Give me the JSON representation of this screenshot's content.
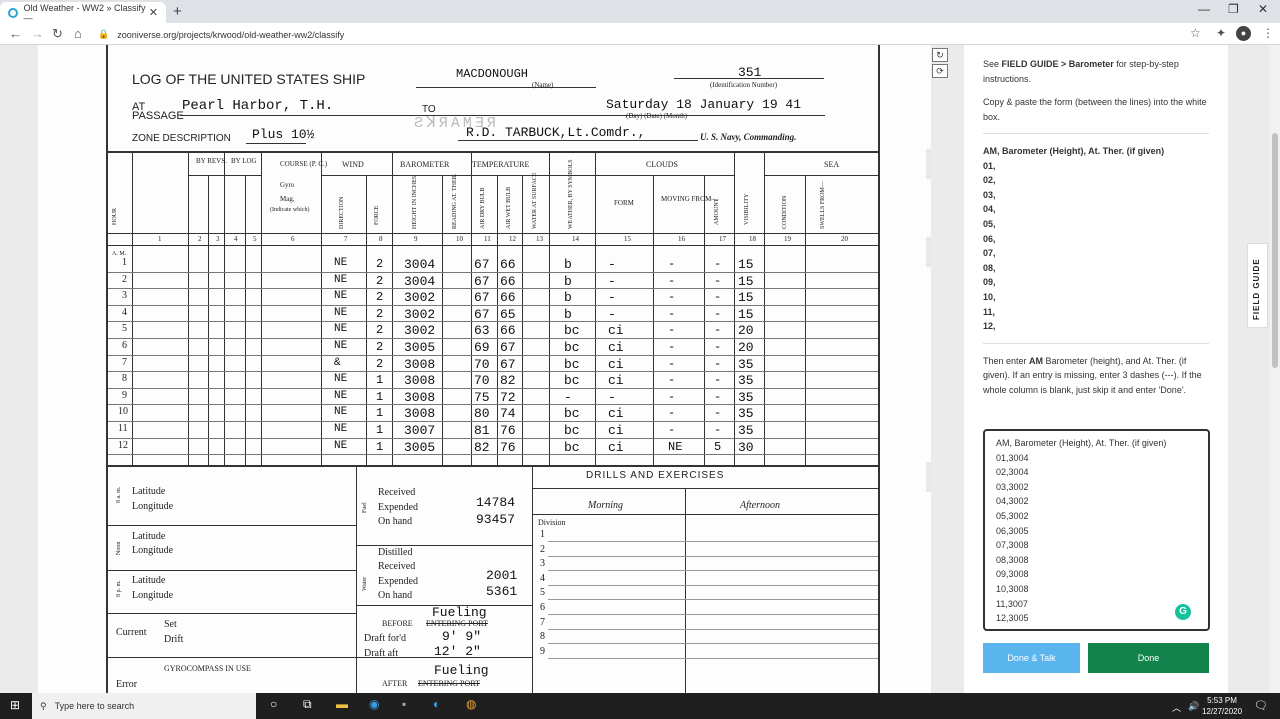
{
  "browser": {
    "tab_title": "Old Weather - WW2 » Classify —",
    "tab_close": "✕",
    "new_tab": "+",
    "url": "zooniverse.org/projects/krwood/old-weather-ww2/classify"
  },
  "log": {
    "header_title": "LOG OF THE UNITED STATES SHIP",
    "ship_name": "MACDONOUGH",
    "name_caption": "(Name)",
    "ident_number": "351",
    "ident_caption": "(Identification Number)",
    "at_label": "AT",
    "passage_label": "PASSAGE",
    "location": "Pearl Harbor, T.H.",
    "to_label": "TO",
    "date_value": "Saturday 18  January 19 41",
    "date_caption": "(Day)     (Date)      (Month)",
    "zone_label": "ZONE DESCRIPTION",
    "zone_value": "Plus 10½",
    "commander": "R.D. TARBUCK,Lt.Comdr.,",
    "commanding_label": "U. S. Navy, Commanding.",
    "col_labels": {
      "hour": "HOUR",
      "revs": "BY REVS.",
      "log": "BY LOG",
      "course": "COURSE (P. C.)",
      "gyro": "Gyro",
      "mag": "Mag.",
      "indicate": "(Indicate which)",
      "wind": "WIND",
      "direction": "DIRECTION",
      "force": "FORCE",
      "barometer": "BAROMETER",
      "height": "HEIGHT IN INCHES",
      "reading": "READING AT. THER.",
      "temperature": "TEMPERATURE",
      "dry": "AIR DRY BULB",
      "wet": "AIR WET BULB",
      "water": "WATER AT SURFACE",
      "weather": "WEATHER, BY SYMBOLS",
      "clouds": "CLOUDS",
      "form": "FORM",
      "moving": "MOVING FROM—",
      "amount": "AMOUNT",
      "visibility": "VISIBILITY",
      "sea": "SEA",
      "condition": "CONDITION",
      "swells": "SWELLS FROM—"
    },
    "col_numbers": [
      "1",
      "2",
      "3",
      "4",
      "5",
      "6",
      "7",
      "8",
      "9",
      "10",
      "11",
      "12",
      "13",
      "14",
      "15",
      "16",
      "17",
      "18",
      "19",
      "20"
    ],
    "am_label": "A. M.",
    "rows": [
      {
        "hour": "1",
        "dir": "NE",
        "force": "2",
        "baro": "3004",
        "dry": "67",
        "wet": "66",
        "weather": "b",
        "form": "-",
        "moving": "-",
        "amount": "-",
        "vis": "15"
      },
      {
        "hour": "2",
        "dir": "NE",
        "force": "2",
        "baro": "3004",
        "dry": "67",
        "wet": "66",
        "weather": "b",
        "form": "-",
        "moving": "-",
        "amount": "-",
        "vis": "15"
      },
      {
        "hour": "3",
        "dir": "NE",
        "force": "2",
        "baro": "3002",
        "dry": "67",
        "wet": "66",
        "weather": "b",
        "form": "-",
        "moving": "-",
        "amount": "-",
        "vis": "15"
      },
      {
        "hour": "4",
        "dir": "NE",
        "force": "2",
        "baro": "3002",
        "dry": "67",
        "wet": "65",
        "weather": "b",
        "form": "-",
        "moving": "-",
        "amount": "-",
        "vis": "15"
      },
      {
        "hour": "5",
        "dir": "NE",
        "force": "2",
        "baro": "3002",
        "dry": "63",
        "wet": "66",
        "weather": "bc",
        "form": "ci",
        "moving": "-",
        "amount": "-",
        "vis": "20"
      },
      {
        "hour": "6",
        "dir": "NE",
        "force": "2",
        "baro": "3005",
        "dry": "69",
        "wet": "67",
        "weather": "bc",
        "form": "ci",
        "moving": "-",
        "amount": "-",
        "vis": "20"
      },
      {
        "hour": "7",
        "dir": "&",
        "force": "2",
        "baro": "3008",
        "dry": "70",
        "wet": "67",
        "weather": "bc",
        "form": "ci",
        "moving": "-",
        "amount": "-",
        "vis": "35"
      },
      {
        "hour": "8",
        "dir": "NE",
        "force": "1",
        "baro": "3008",
        "dry": "70",
        "wet": "82",
        "weather": "bc",
        "form": "ci",
        "moving": "-",
        "amount": "-",
        "vis": "35"
      },
      {
        "hour": "9",
        "dir": "NE",
        "force": "1",
        "baro": "3008",
        "dry": "75",
        "wet": "72",
        "weather": "-",
        "form": "-",
        "moving": "-",
        "amount": "-",
        "vis": "35"
      },
      {
        "hour": "10",
        "dir": "NE",
        "force": "1",
        "baro": "3008",
        "dry": "80",
        "wet": "74",
        "weather": "bc",
        "form": "ci",
        "moving": "-",
        "amount": "-",
        "vis": "35"
      },
      {
        "hour": "11",
        "dir": "NE",
        "force": "1",
        "baro": "3007",
        "dry": "81",
        "wet": "76",
        "weather": "bc",
        "form": "ci",
        "moving": "-",
        "amount": "-",
        "vis": "35"
      },
      {
        "hour": "12",
        "dir": "NE",
        "force": "1",
        "baro": "3005",
        "dry": "82",
        "wet": "76",
        "weather": "bc",
        "form": "ci",
        "moving": "NE",
        "amount": "5",
        "vis": "30"
      }
    ],
    "lower": {
      "latitude": "Latitude",
      "longitude": "Longitude",
      "am_label": "8 a. m.",
      "noon_label": "Noon",
      "pm_label": "8 p. m.",
      "current": "Current",
      "set": "Set",
      "drift": "Drift",
      "gyrocompass": "GYROCOMPASS IN USE",
      "error": "Error",
      "fuel_label": "Fuel",
      "water_label": "Water",
      "received": "Received",
      "expended": "Expended",
      "on_hand": "On hand",
      "distilled": "Distilled",
      "fuel_expended": "14784",
      "fuel_on_hand": "93457",
      "water_expended": "2001",
      "water_on_hand": "5361",
      "before": "BEFORE",
      "after": "AFTER",
      "entering_port": "ENTERING PORT",
      "fueling1": "Fueling",
      "fueling2": "Fueling",
      "draft_fwd_label": "Draft for'd",
      "draft_aft_label": "Draft aft",
      "draft_fwd": "9' 9\"",
      "draft_aft": "12' 2\"",
      "drills": "DRILLS AND EXERCISES",
      "morning": "Morning",
      "afternoon": "Afternoon",
      "division": "Division",
      "div_numbers": [
        "1",
        "2",
        "3",
        "4",
        "5",
        "6",
        "7",
        "8",
        "9"
      ]
    }
  },
  "sidebar": {
    "intro_pre": "See ",
    "intro_bold": "FIELD GUIDE > Barometer",
    "intro_post": " for step-by-step instructions.",
    "copy_text": "Copy & paste the form (between the lines) into the white box.",
    "form_lines": [
      "AM, Barometer (Height), At. Ther. (if given)",
      "01,",
      "02,",
      "03,",
      "04,",
      "05,",
      "06,",
      "07,",
      "08,",
      "09,",
      "10,",
      "11,",
      "12,"
    ],
    "then_pre": "Then enter ",
    "then_bold": "AM",
    "then_post": " Barometer (height), and At. Ther. (if given). If an entry is missing, enter 3 dashes (---). If the whole column is blank, just skip it and enter 'Done'.",
    "textarea_lines": [
      "AM, Barometer (Height), At. Ther. (if given)",
      "01,3004",
      "02,3004",
      "03,3002",
      "04,3002",
      "05,3002",
      "06,3005",
      "07,3008",
      "08,3008",
      "09,3008",
      "10,3008",
      "11,3007",
      "12,3005"
    ],
    "done_talk_label": "Done & Talk",
    "done_label": "Done",
    "field_guide_label": "FIELD GUIDE",
    "colors": {
      "done_talk": "#5ab4ee",
      "done": "#12834a"
    }
  },
  "taskbar": {
    "search_placeholder": "Type here to search",
    "time": "5:53 PM",
    "date": "12/27/2020"
  }
}
